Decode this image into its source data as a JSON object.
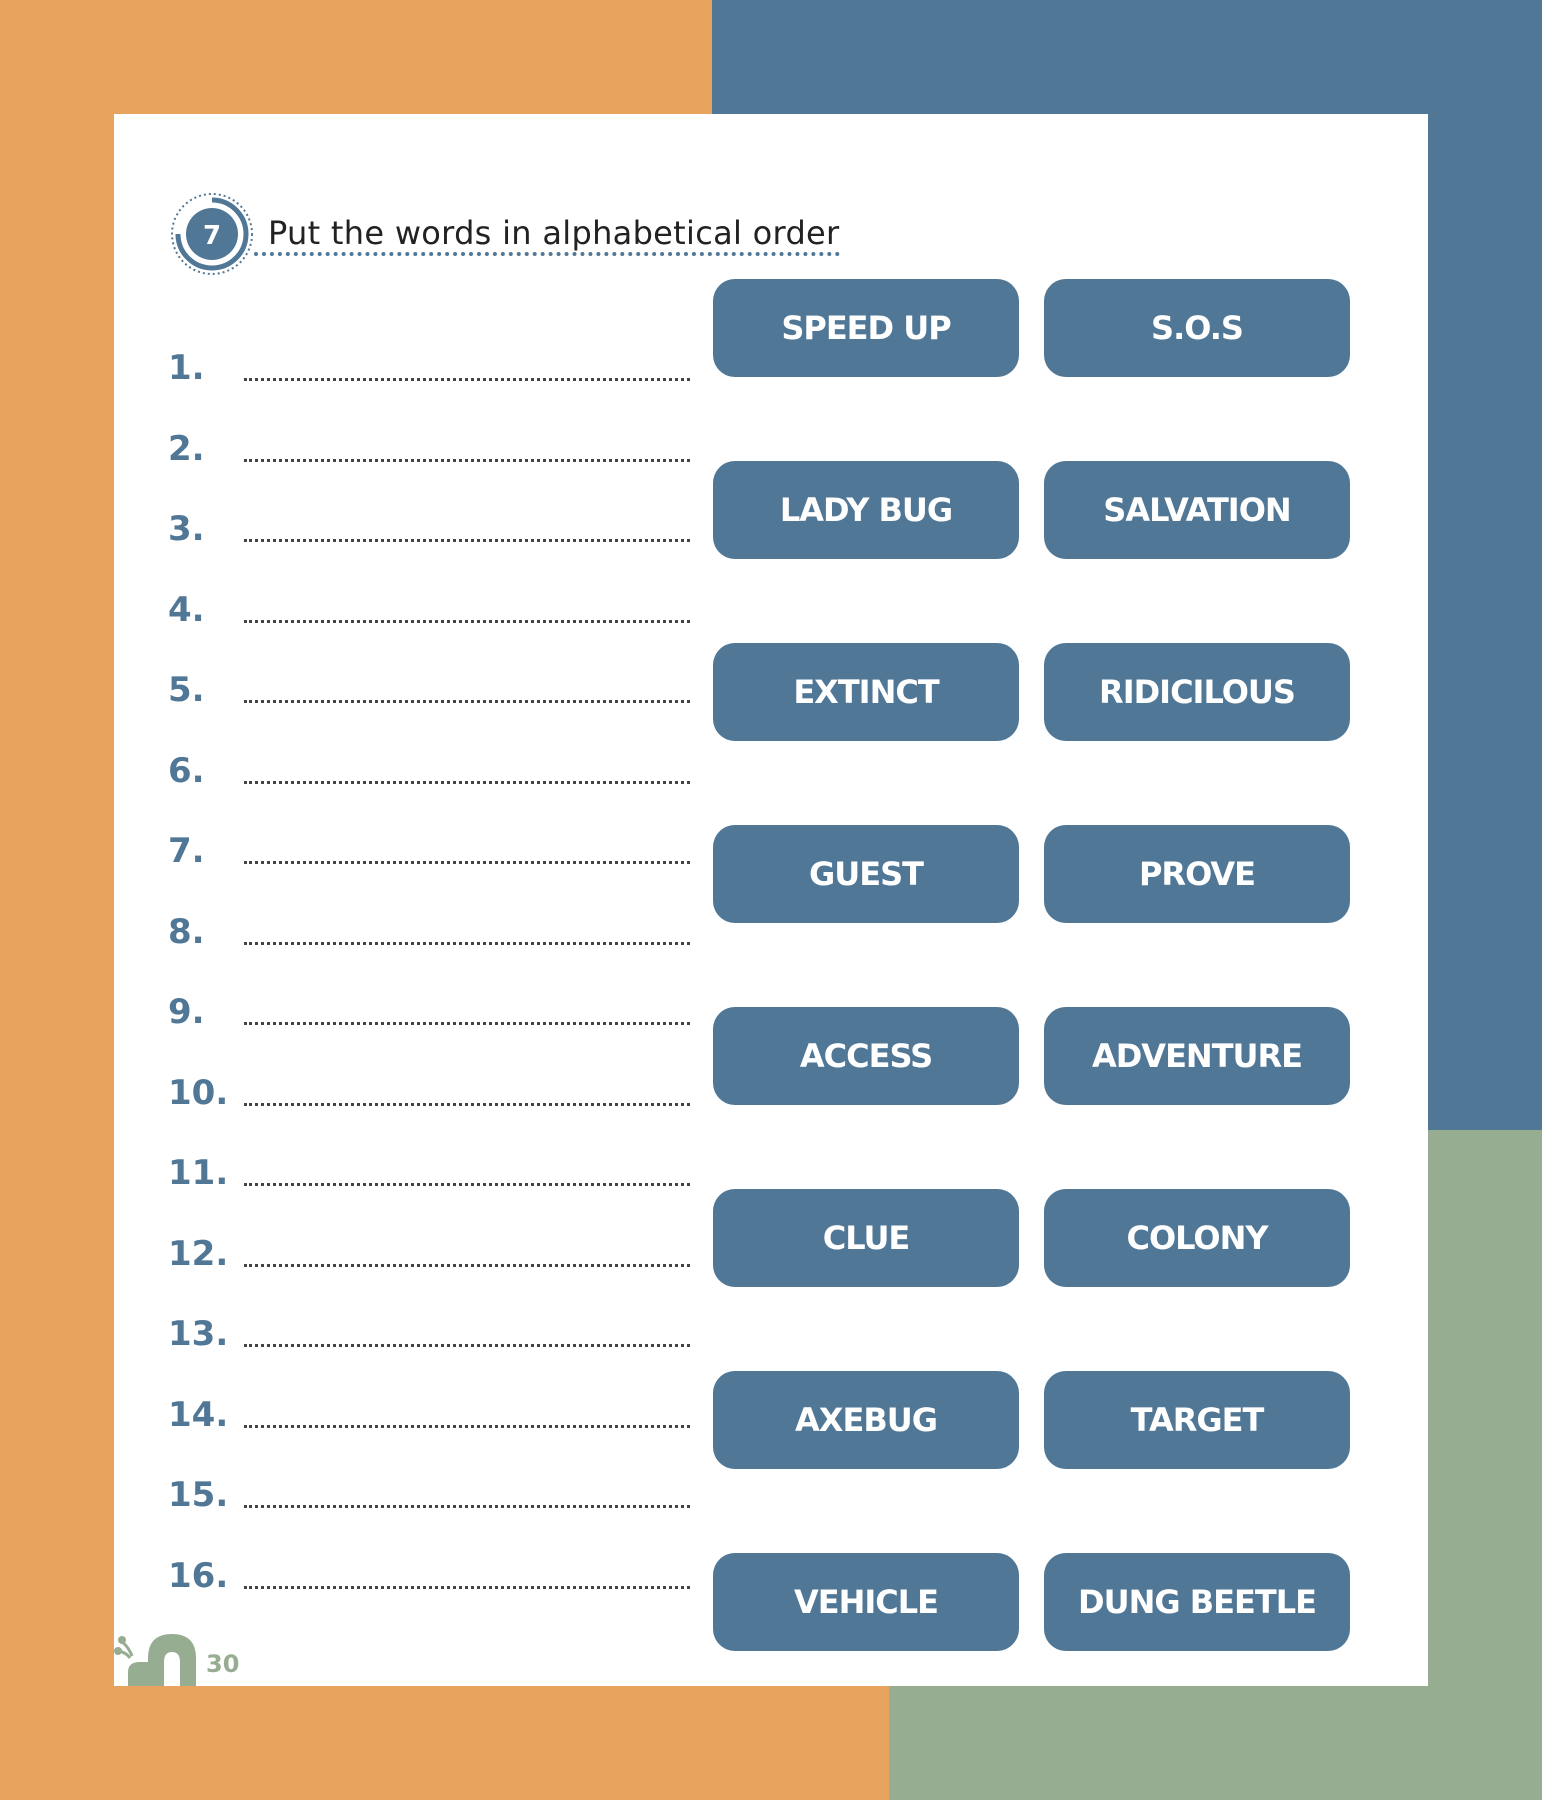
{
  "exercise": {
    "number": "7",
    "instruction": "Put the words in alphabetical order"
  },
  "answer_lines": [
    {
      "label": "1."
    },
    {
      "label": "2."
    },
    {
      "label": "3."
    },
    {
      "label": "4."
    },
    {
      "label": "5."
    },
    {
      "label": "6."
    },
    {
      "label": "7."
    },
    {
      "label": "8."
    },
    {
      "label": "9."
    },
    {
      "label": "10."
    },
    {
      "label": "11."
    },
    {
      "label": "12."
    },
    {
      "label": "13."
    },
    {
      "label": "14."
    },
    {
      "label": "15."
    },
    {
      "label": "16."
    }
  ],
  "word_bank": [
    "SPEED UP",
    "S.O.S",
    "LADY BUG",
    "SALVATION",
    "EXTINCT",
    "RIDICILOUS",
    "GUEST",
    "PROVE",
    "ACCESS",
    "ADVENTURE",
    "CLUE",
    "COLONY",
    "AXEBUG",
    "TARGET",
    "VEHICLE",
    "DUNG BEETLE"
  ],
  "footer": {
    "page_number": "30",
    "mascot_icon": "snail-icon"
  },
  "colors": {
    "orange": "#e8a45f",
    "blue": "#517796",
    "green": "#97ad92",
    "page": "#ffffff"
  }
}
